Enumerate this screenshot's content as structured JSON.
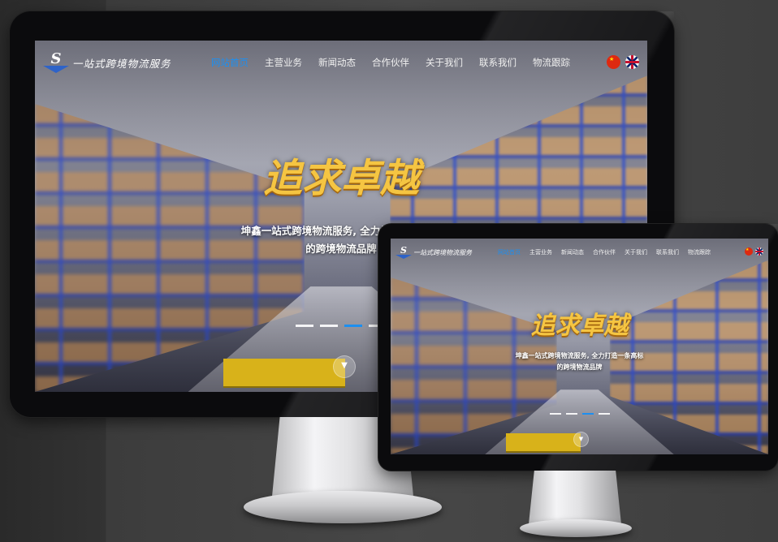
{
  "site": {
    "logo_text": "一站式跨境物流服务",
    "logo_letter": "S",
    "menu": [
      {
        "label": "网站首页",
        "active": true
      },
      {
        "label": "主营业务",
        "active": false
      },
      {
        "label": "新闻动态",
        "active": false
      },
      {
        "label": "合作伙伴",
        "active": false
      },
      {
        "label": "关于我们",
        "active": false
      },
      {
        "label": "联系我们",
        "active": false
      },
      {
        "label": "物流跟踪",
        "active": false
      }
    ],
    "languages": [
      {
        "icon": "china-flag-icon",
        "code": "cn"
      },
      {
        "icon": "uk-flag-icon",
        "code": "en"
      }
    ],
    "hero": {
      "slogan": "追求卓越",
      "subtitle_line1": "坤鑫一站式跨境物流服务, 全力打造一条高标",
      "subtitle_line2": "的跨境物流品牌",
      "slides_count": 4,
      "active_slide": 3,
      "scroll_icon": "chevron-down-icon"
    },
    "colors": {
      "accent": "#1d8ff0",
      "slogan_gold": "#f5c542",
      "pallet_yellow": "#d8b21a",
      "rack_blue": "#2846c8"
    }
  }
}
